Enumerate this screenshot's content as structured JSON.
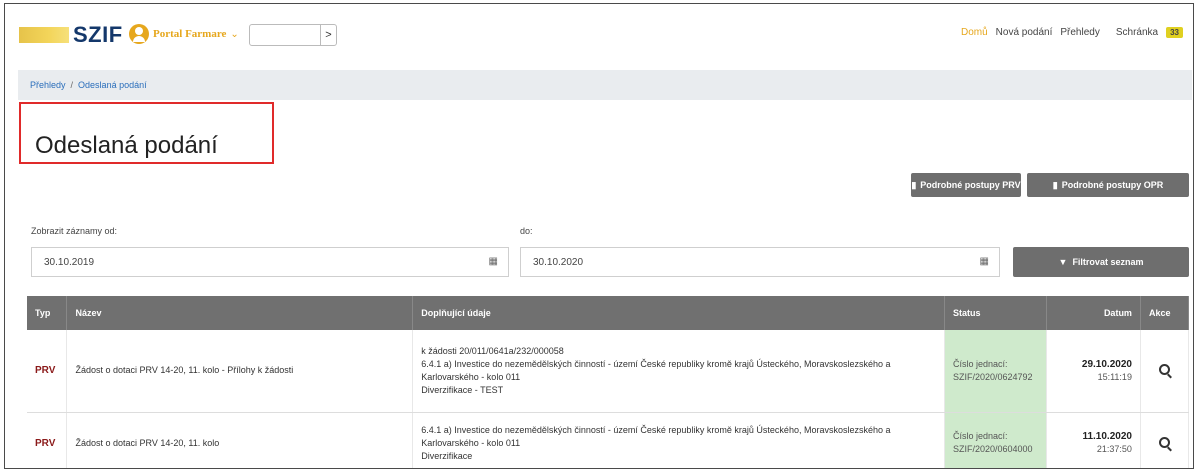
{
  "header": {
    "logo": "SZIF",
    "portal_label": "Portal Farmare",
    "search_go": ">",
    "nav": {
      "home": "Domů",
      "new": "Nová podání",
      "overviews": "Přehledy",
      "inbox": "Schránka",
      "inbox_count": "33"
    }
  },
  "breadcrumb": {
    "item1": "Přehledy",
    "separator": "/",
    "item2": "Odeslaná podání"
  },
  "page": {
    "title": "Odeslaná podání"
  },
  "buttons": {
    "prv": "Podrobné postupy PRV",
    "opr": "Podrobné postupy OPR",
    "filter": "Filtrovat seznam"
  },
  "filter": {
    "from_label": "Zobrazit záznamy od:",
    "from_value": "30.10.2019",
    "to_label": "do:",
    "to_value": "30.10.2020"
  },
  "table": {
    "headers": {
      "typ": "Typ",
      "nazev": "Název",
      "doplnujici": "Doplňující údaje",
      "status": "Status",
      "datum": "Datum",
      "akce": "Akce"
    },
    "rows": [
      {
        "typ": "PRV",
        "nazev": "Žádost o dotaci PRV 14-20, 11. kolo - Přílohy k žádosti",
        "info1": "k žádosti 20/011/0641a/232/000058",
        "info2": "6.4.1 a) Investice do nezemědělských činností - území České republiky kromě krajů Ústeckého, Moravskoslezského a Karlovarského - kolo 011",
        "info3": "Diverzifikace - TEST",
        "status1": "Číslo jednací:",
        "status2": "SZIF/2020/0624792",
        "date": "29.10.2020",
        "time": "15:11:19"
      },
      {
        "typ": "PRV",
        "nazev": "Žádost o dotaci PRV 14-20, 11. kolo",
        "info1": "",
        "info2": "6.4.1 a) Investice do nezemědělských činností - území České republiky kromě krajů Ústeckého, Moravskoslezského a Karlovarského - kolo 011",
        "info3": "Diverzifikace",
        "status1": "Číslo jednací:",
        "status2": "SZIF/2020/0604000",
        "date": "11.10.2020",
        "time": "21:37:50"
      }
    ]
  },
  "colors": {
    "accent": "#e6a71d",
    "brand": "#14386b",
    "highlight_border": "#e02a2a",
    "status_bg": "#cfeacc",
    "button_bg": "#6e6e6e"
  }
}
